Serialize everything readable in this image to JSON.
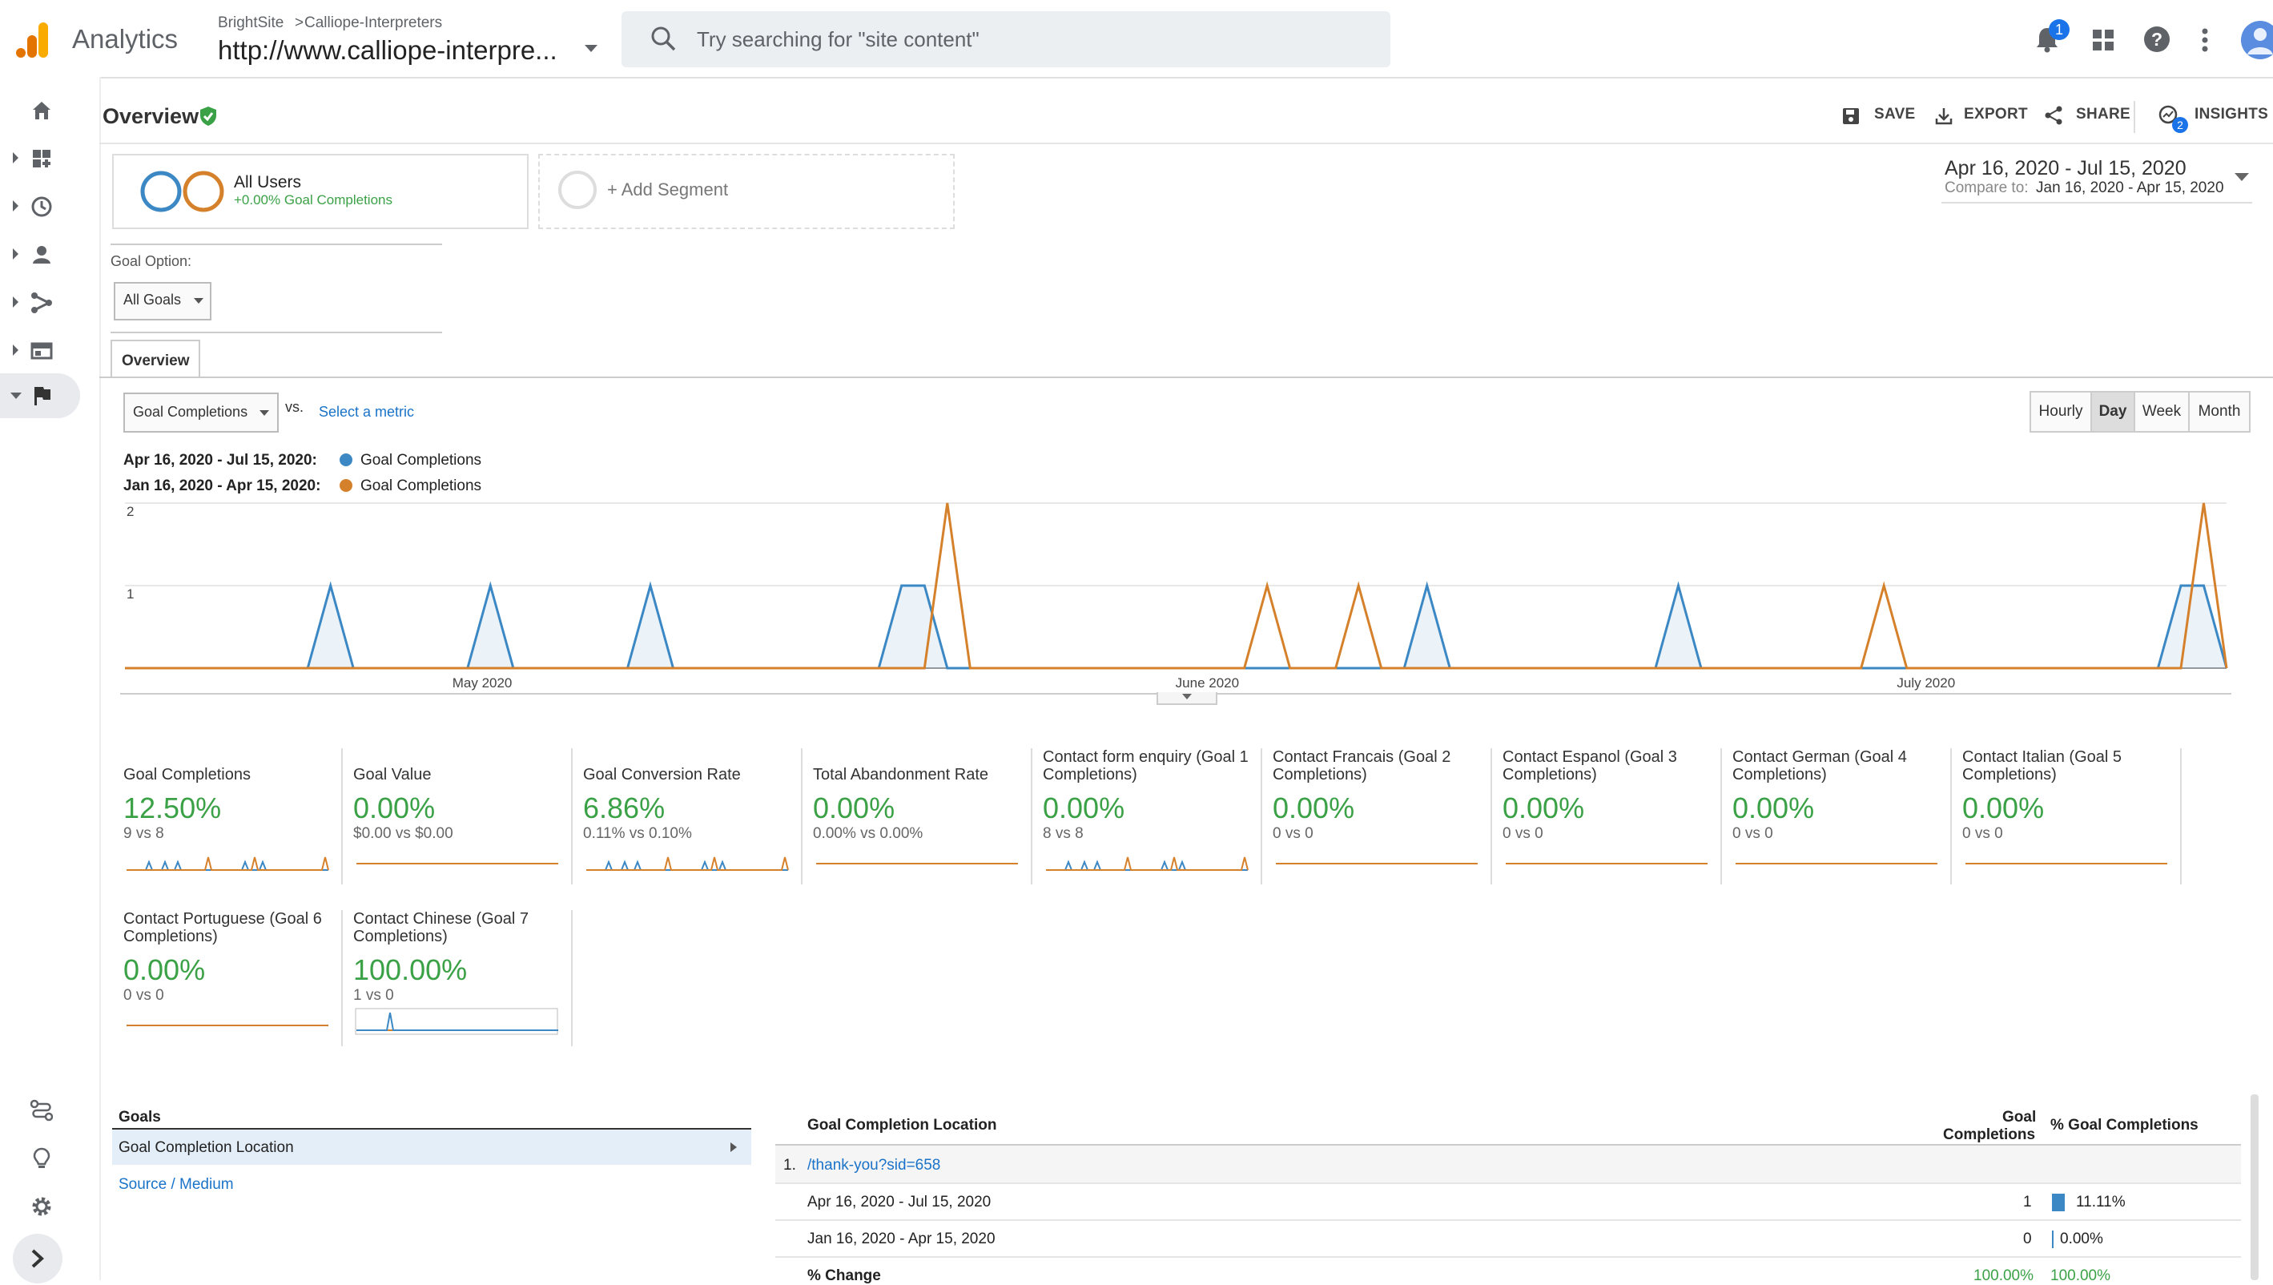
{
  "app": {
    "name": "Analytics",
    "account": "BrightSite",
    "property": "Calliope-Interpreters",
    "view": "http://www.calliope-interpre...",
    "notification_count": "1"
  },
  "search": {
    "placeholder": "Try searching for \"site content\""
  },
  "page": {
    "title": "Overview",
    "actions": {
      "save": "SAVE",
      "export": "EXPORT",
      "share": "SHARE",
      "insights": "INSIGHTS",
      "insights_badge": "2"
    }
  },
  "segments": {
    "all_users": "All Users",
    "all_users_sub": "+0.00% Goal Completions",
    "add": "+ Add Segment"
  },
  "date_range": {
    "primary": "Apr 16, 2020 - Jul 15, 2020",
    "compare_label": "Compare to:",
    "compare": "Jan 16, 2020 - Apr 15, 2020"
  },
  "goal_option": {
    "label": "Goal Option:",
    "value": "All Goals"
  },
  "tabs": {
    "overview": "Overview"
  },
  "metric_picker": {
    "value": "Goal Completions",
    "vs": "vs.",
    "select": "Select a metric"
  },
  "granularity": {
    "hourly": "Hourly",
    "day": "Day",
    "week": "Week",
    "month": "Month",
    "selected": "Day"
  },
  "legend": {
    "row1_date": "Apr 16, 2020 - Jul 15, 2020:",
    "row1_series": "Goal Completions",
    "row2_date": "Jan 16, 2020 - Apr 15, 2020:",
    "row2_series": "Goal Completions"
  },
  "colors": {
    "blue": "#3b88c4",
    "orange": "#d5812c",
    "green": "#3ba146",
    "link": "#1a73c8"
  },
  "chart_data": {
    "type": "line",
    "x_labels": [
      "May 2020",
      "June 2020",
      "July 2020"
    ],
    "ylim": [
      0,
      2
    ],
    "yticks": [
      "1",
      "2"
    ],
    "series": [
      {
        "name": "Apr 16, 2020 - Jul 15, 2020",
        "values": [
          0,
          0,
          0,
          0,
          0,
          0,
          0,
          0,
          0,
          1,
          0,
          0,
          0,
          0,
          0,
          0,
          1,
          0,
          0,
          0,
          0,
          0,
          0,
          1,
          0,
          0,
          0,
          0,
          0,
          0,
          0,
          0,
          0,
          0,
          1,
          1,
          0,
          0,
          0,
          0,
          0,
          0,
          0,
          0,
          0,
          0,
          0,
          0,
          0,
          0,
          0,
          0,
          0,
          0,
          0,
          0,
          0,
          1,
          0,
          0,
          0,
          0,
          0,
          0,
          0,
          0,
          0,
          0,
          1,
          0,
          0,
          0,
          0,
          0,
          0,
          0,
          0,
          0,
          0,
          0,
          0,
          0,
          0,
          0,
          0,
          0,
          0,
          0,
          0,
          0,
          1,
          1,
          0
        ]
      },
      {
        "name": "Jan 16, 2020 - Apr 15, 2020",
        "values": [
          0,
          0,
          0,
          0,
          0,
          0,
          0,
          0,
          0,
          0,
          0,
          0,
          0,
          0,
          0,
          0,
          0,
          0,
          0,
          0,
          0,
          0,
          0,
          0,
          0,
          0,
          0,
          0,
          0,
          0,
          0,
          0,
          0,
          0,
          0,
          0,
          2,
          0,
          0,
          0,
          0,
          0,
          0,
          0,
          0,
          0,
          0,
          0,
          0,
          0,
          1,
          0,
          0,
          0,
          1,
          0,
          0,
          0,
          0,
          0,
          0,
          0,
          0,
          0,
          0,
          0,
          0,
          0,
          0,
          0,
          0,
          0,
          0,
          0,
          0,
          0,
          0,
          1,
          0,
          0,
          0,
          0,
          0,
          0,
          0,
          0,
          0,
          0,
          0,
          0,
          0,
          2,
          0
        ]
      }
    ]
  },
  "scorecards": [
    {
      "title": "Goal Completions",
      "value": "12.50%",
      "sub": "9 vs 8"
    },
    {
      "title": "Goal Value",
      "value": "0.00%",
      "sub": "$0.00 vs $0.00"
    },
    {
      "title": "Goal Conversion Rate",
      "value": "6.86%",
      "sub": "0.11% vs 0.10%"
    },
    {
      "title": "Total Abandonment Rate",
      "value": "0.00%",
      "sub": "0.00% vs 0.00%"
    },
    {
      "title": "Contact form enquiry (Goal 1 Completions)",
      "value": "0.00%",
      "sub": "8 vs 8"
    },
    {
      "title": "Contact Francais (Goal 2 Completions)",
      "value": "0.00%",
      "sub": "0 vs 0"
    },
    {
      "title": "Contact Espanol (Goal 3 Completions)",
      "value": "0.00%",
      "sub": "0 vs 0"
    },
    {
      "title": "Contact German (Goal 4 Completions)",
      "value": "0.00%",
      "sub": "0 vs 0"
    },
    {
      "title": "Contact Italian (Goal 5 Completions)",
      "value": "0.00%",
      "sub": "0 vs 0"
    },
    {
      "title": "Contact Portuguese (Goal 6 Completions)",
      "value": "0.00%",
      "sub": "0 vs 0"
    },
    {
      "title": "Contact Chinese (Goal 7 Completions)",
      "value": "100.00%",
      "sub": "1 vs 0"
    }
  ],
  "goals_panel": {
    "header": "Goals",
    "items": [
      "Goal Completion Location",
      "Source / Medium"
    ]
  },
  "table": {
    "col1": "Goal Completion Location",
    "col2a": "Goal",
    "col2b": "Completions",
    "col3": "% Goal Completions",
    "row_index": "1.",
    "row_link": "/thank-you?sid=658",
    "rows": [
      {
        "label": "Apr 16, 2020 - Jul 15, 2020",
        "value": "1",
        "pct": "11.11%",
        "bar": 0.1111
      },
      {
        "label": "Jan 16, 2020 - Apr 15, 2020",
        "value": "0",
        "pct": "0.00%",
        "bar": 0
      }
    ],
    "change_label": "% Change",
    "change_value": "100.00%",
    "change_pct": "100.00%"
  }
}
